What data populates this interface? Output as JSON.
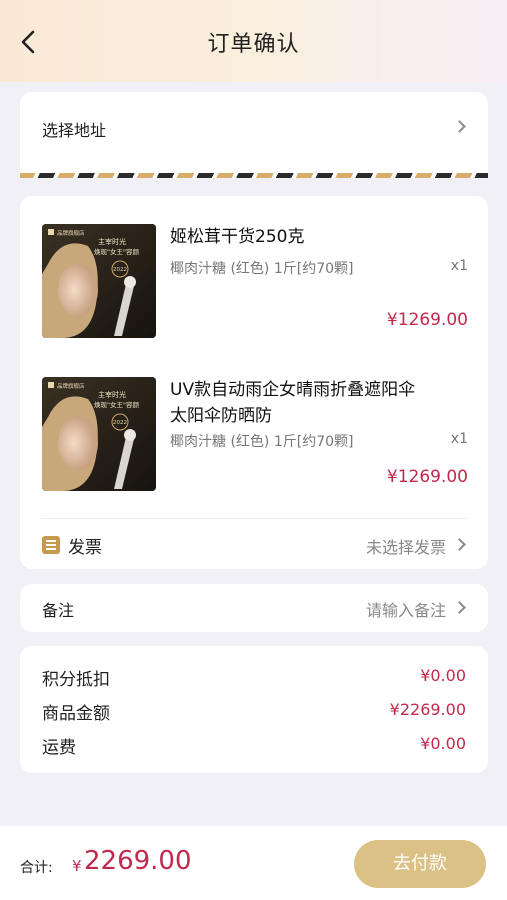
{
  "header": {
    "title": "订单确认",
    "back_icon": "chevron-left-icon"
  },
  "address": {
    "label": "选择地址"
  },
  "items": [
    {
      "title_lines": [
        "姬松茸干货250克"
      ],
      "spec": "椰肉汁糖 (红色) 1斤[约70颗]",
      "qty": "x1",
      "price": "¥1269.00",
      "thumb": {
        "brand": "品牌旗舰店",
        "tag1": "主宰时光",
        "tag2": "焕现\"女王\"容颜",
        "year": "2022"
      }
    },
    {
      "title_lines": [
        "UV款自动雨企女晴雨折叠遮阳伞",
        "太阳伞防晒防"
      ],
      "spec": "椰肉汁糖 (红色) 1斤[约70颗]",
      "qty": "x1",
      "price": "¥1269.00",
      "thumb": {
        "brand": "品牌旗舰店",
        "tag1": "主宰时光",
        "tag2": "焕现\"女王\"容颜",
        "year": "2022"
      }
    }
  ],
  "invoice": {
    "label": "发票",
    "value": "未选择发票",
    "icon": "invoice-icon"
  },
  "note": {
    "label": "备注",
    "placeholder": "请输入备注"
  },
  "summary": [
    {
      "label": "积分抵扣",
      "value": "¥0.00"
    },
    {
      "label": "商品金额",
      "value": "¥2269.00"
    },
    {
      "label": "运费",
      "value": "¥0.00"
    }
  ],
  "footer": {
    "total_label": "合计:",
    "currency": "¥",
    "total_amount": "2269.00",
    "pay_label": "去付款"
  },
  "colors": {
    "accent_price": "#c2294c",
    "pay_button": "#dcc187",
    "gold": "#c59a4c"
  }
}
